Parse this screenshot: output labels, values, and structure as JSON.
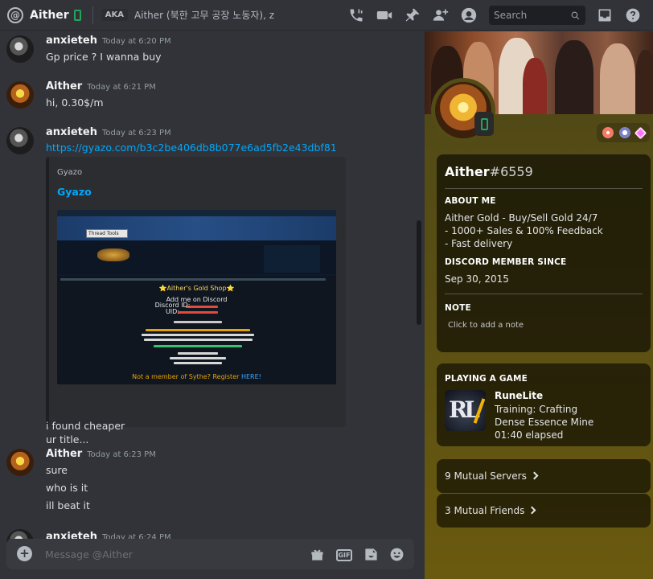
{
  "header": {
    "dm_name": "Aither",
    "aka_badge": "AKA",
    "aka_names": "Aither (북한 고무 공장 노동자), z",
    "search_placeholder": "Search"
  },
  "messages": [
    {
      "author": "anxieteh",
      "timestamp": "Today at 6:20 PM",
      "lines": [
        "Gp price ? I wanna buy"
      ]
    },
    {
      "author": "Aither",
      "timestamp": "Today at 6:21 PM",
      "lines": [
        "hi, 0.30$/m"
      ]
    },
    {
      "author": "anxieteh",
      "timestamp": "Today at 6:23 PM",
      "link": "https://gyazo.com/b3c2be406db8b077e6ad5fb2e43dbf81",
      "embed": {
        "provider": "Gyazo",
        "title": "Gyazo",
        "image_popup": "Thread Tools",
        "image_shop_title": "⭐Aither's Gold Shop⭐",
        "image_add": "Add me on Discord",
        "image_discord_id": "Discord ID:",
        "image_uid": "UID:",
        "image_footer_prefix": "Not a member of Sythe? Register",
        "image_footer_link": "HERE!"
      },
      "lines": [
        "ur title...",
        "i found cheaper"
      ]
    },
    {
      "author": "Aither",
      "timestamp": "Today at 6:23 PM",
      "lines": [
        "sure",
        "who is it",
        "ill beat it"
      ]
    },
    {
      "author": "anxieteh",
      "timestamp": "Today at 6:24 PM",
      "lines": []
    }
  ],
  "composer": {
    "placeholder": "Message @Aither",
    "gif_label": "GIF"
  },
  "profile": {
    "display_name": "Aither",
    "discriminator": "#6559",
    "about_title": "ABOUT ME",
    "about_lines": [
      "Aither Gold - Buy/Sell Gold 24/7",
      "- 1000+ Sales & 100% Feedback",
      "- Fast delivery"
    ],
    "member_since_title": "DISCORD MEMBER SINCE",
    "member_since": "Sep 30, 2015",
    "note_title": "NOTE",
    "note_placeholder": "Click to add a note",
    "playing_title": "PLAYING A GAME",
    "game_name": "RuneLite",
    "game_detail": "Training: Crafting",
    "game_state": "Dense Essence Mine",
    "game_elapsed": "01:40 elapsed",
    "mutual_servers": "9 Mutual Servers",
    "mutual_friends": "3 Mutual Friends"
  },
  "colors": {
    "link": "#00a8fc",
    "online": "#23a55a",
    "panel_accent": "#584e14"
  }
}
